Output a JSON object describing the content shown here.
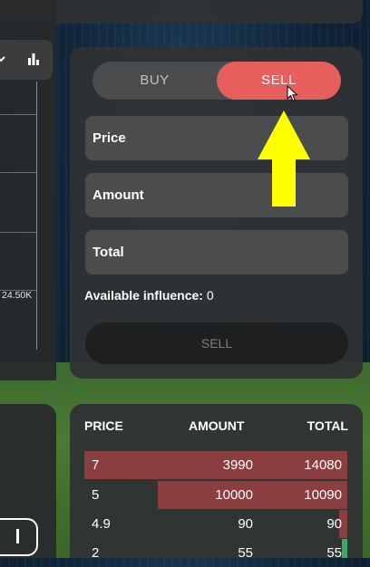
{
  "trade": {
    "tabs": {
      "buy": "BUY",
      "sell": "SELL",
      "active": "sell"
    },
    "fields": {
      "price": "Price",
      "amount": "Amount",
      "total": "Total"
    },
    "available_label": "Available influence:",
    "available_value": "0",
    "submit_label": "SELL"
  },
  "chart": {
    "price_tag": "24.50K"
  },
  "orderbook": {
    "headers": {
      "price": "PRICE",
      "amount": "AMOUNT",
      "total": "TOTAL"
    },
    "rows": [
      {
        "price": "7",
        "amount": "3990",
        "total": "14080",
        "depth": 1.0
      },
      {
        "price": "5",
        "amount": "10000",
        "total": "10090",
        "depth": 0.72
      },
      {
        "price": "4.9",
        "amount": "90",
        "total": "90",
        "depth": 0.03
      },
      {
        "price": "2",
        "amount": "55",
        "total": "55",
        "depth": 0.0
      }
    ]
  },
  "colors": {
    "sell_accent": "#e65f5d",
    "ask_bar": "#8b3e40",
    "highlight_arrow": "#ffff00"
  },
  "icons": [
    "bar-chart-icon",
    "chevron-down-icon",
    "cursor-pointer-icon",
    "up-arrow-annotation-icon"
  ]
}
